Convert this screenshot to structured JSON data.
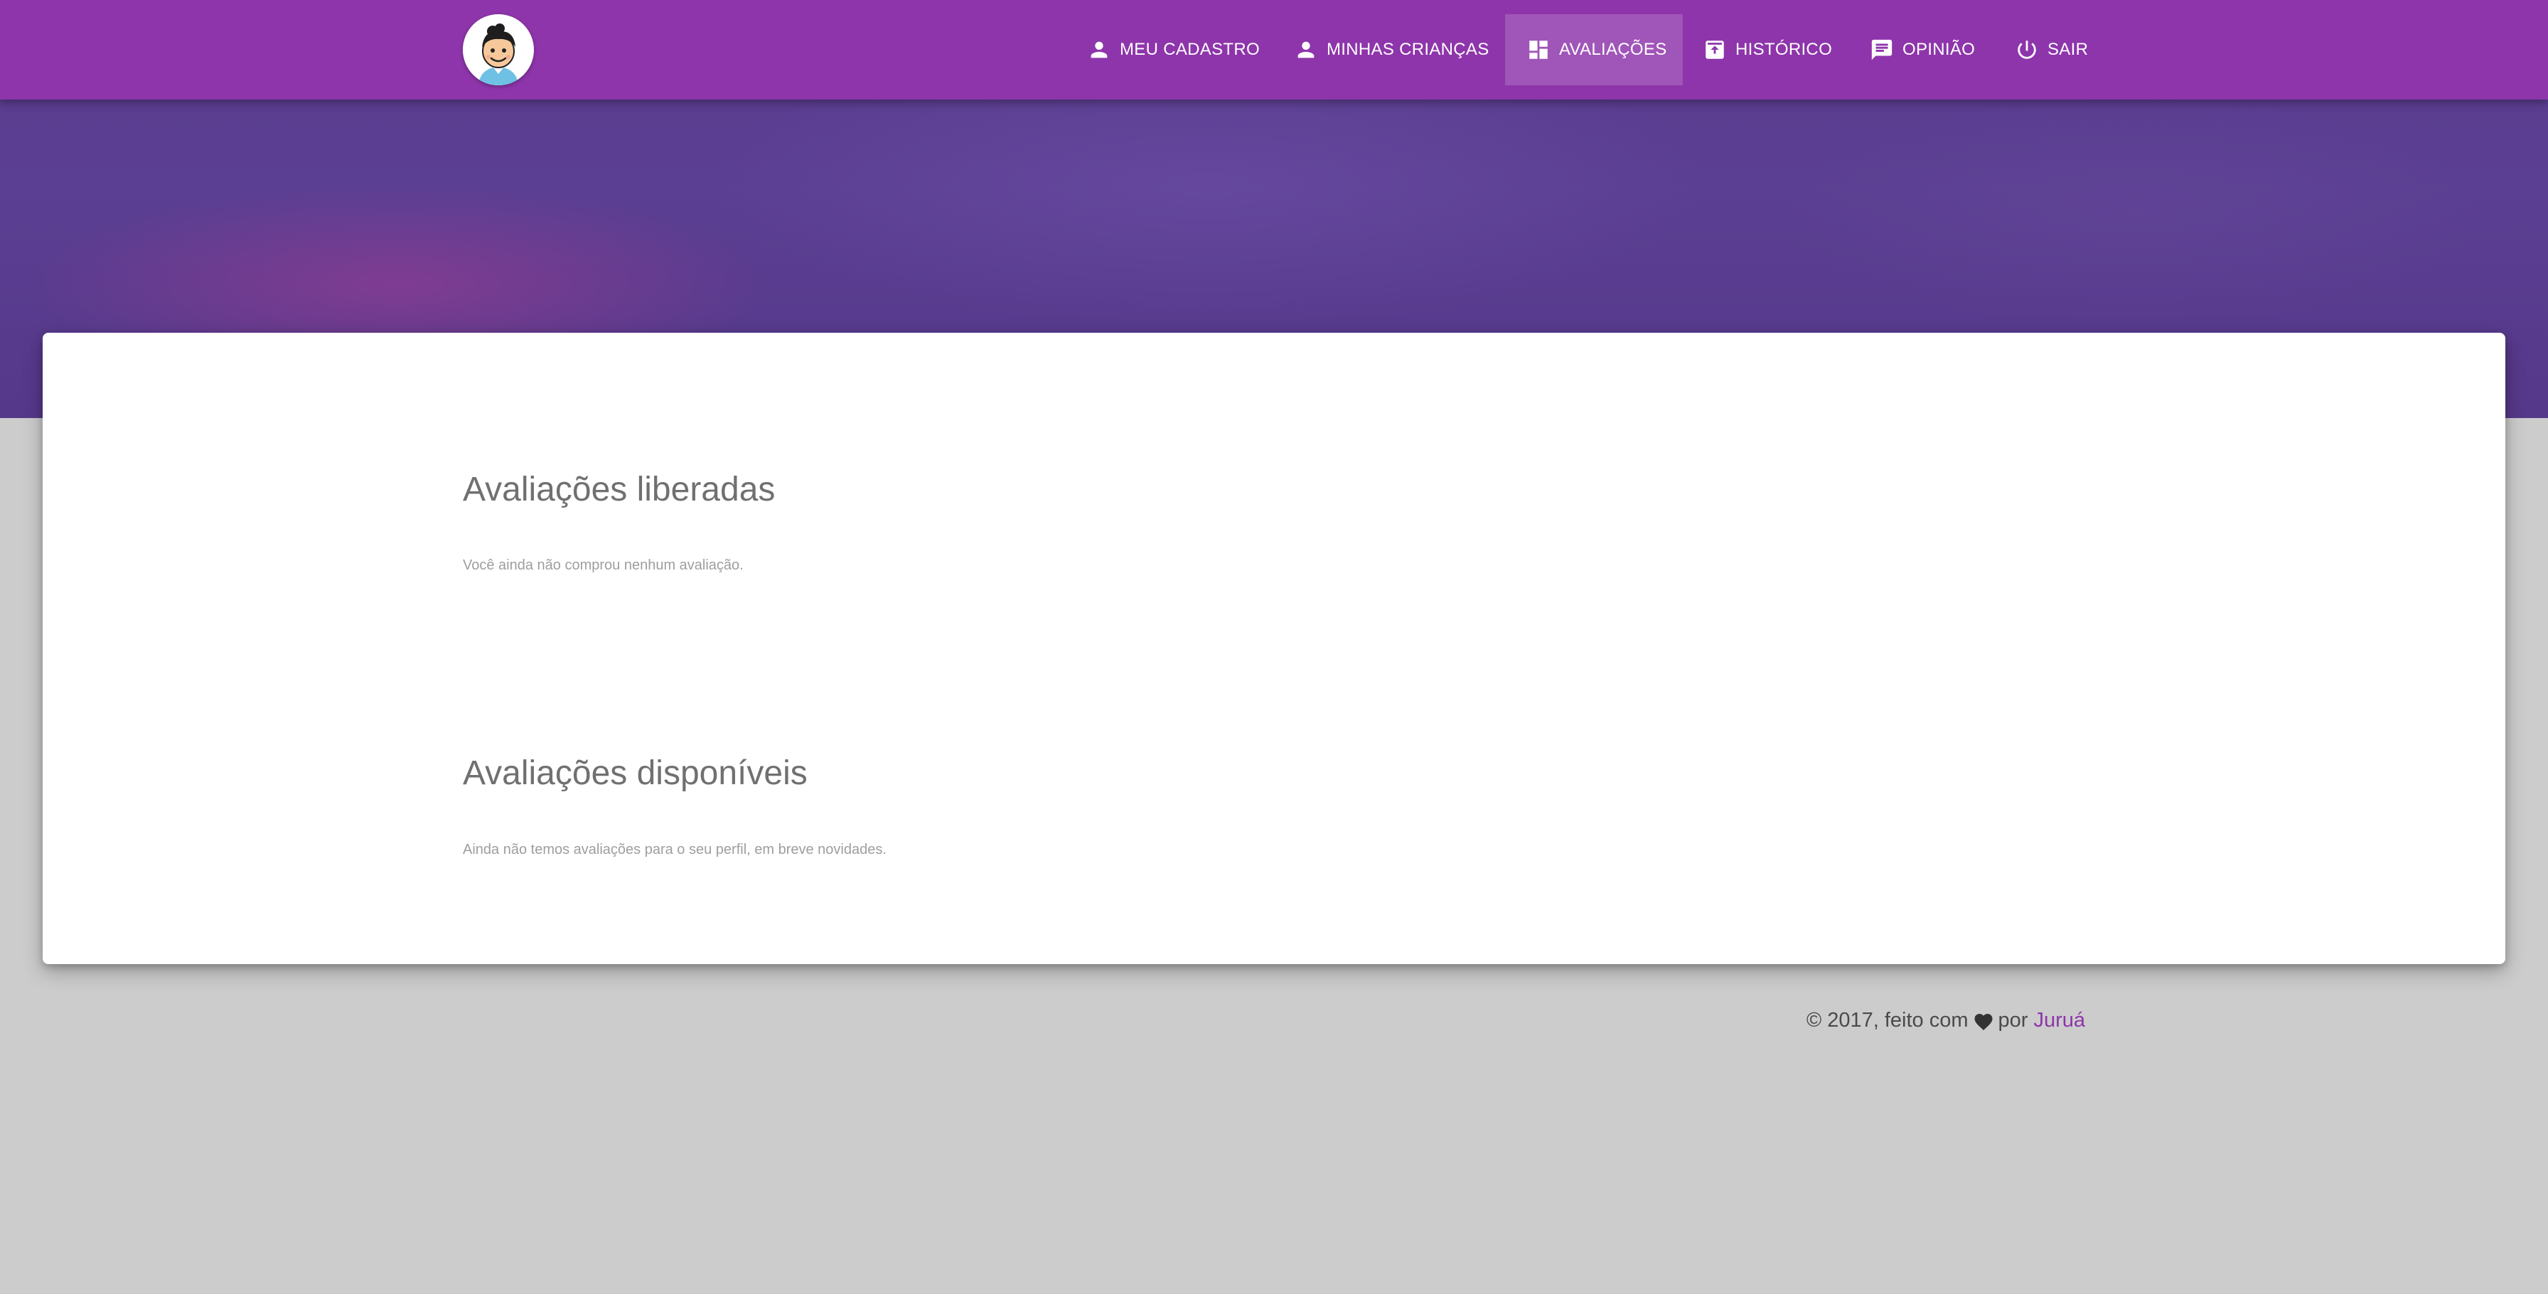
{
  "colors": {
    "brand": "#8e35ab",
    "hero": "#5b3f92",
    "page_background": "#cccccc"
  },
  "header": {
    "logo_icon": "boy-avatar-icon",
    "nav": [
      {
        "label": "MEU CADASTRO",
        "icon": "person-icon",
        "active": false
      },
      {
        "label": "MINHAS CRIANÇAS",
        "icon": "person-icon",
        "active": false
      },
      {
        "label": "AVALIAÇÕES",
        "icon": "dashboard-icon",
        "active": true
      },
      {
        "label": "HISTÓRICO",
        "icon": "archive-icon",
        "active": false
      },
      {
        "label": "OPINIÃO",
        "icon": "comment-icon",
        "active": false
      },
      {
        "label": "SAIR",
        "icon": "power-icon",
        "active": false
      }
    ]
  },
  "main": {
    "liberadas": {
      "title": "Avaliações liberadas",
      "empty_text": "Você ainda não comprou nenhum avaliação."
    },
    "disponiveis": {
      "title": "Avaliações disponíveis",
      "empty_text": "Ainda não temos avaliações para o seu perfil, em breve novidades."
    }
  },
  "footer": {
    "prefix": "© 2017, feito com",
    "icon": "heart-icon",
    "middle": "por",
    "link": "Juruá"
  }
}
